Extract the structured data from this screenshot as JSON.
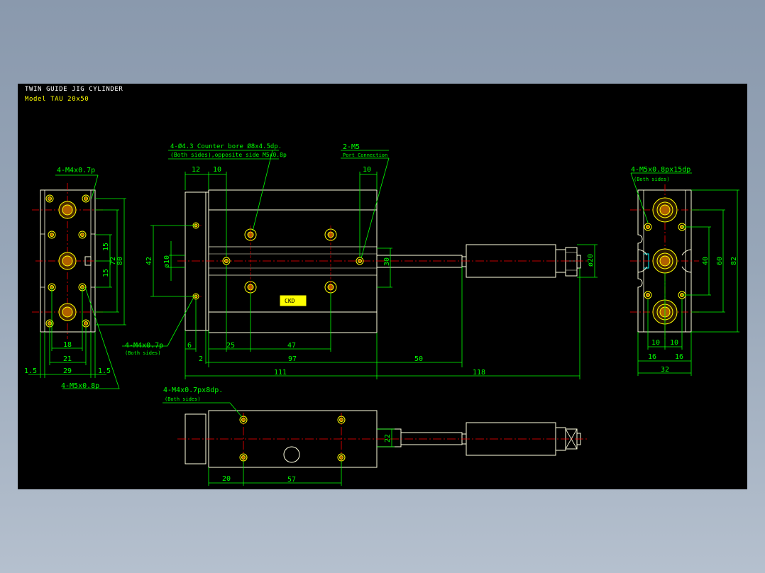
{
  "title_block": {
    "line1": "TWIN GUIDE JIG CYLINDER",
    "line2": "Model TAU 20x50"
  },
  "colors": {
    "background": "#000000",
    "outline": "#ffffe0",
    "dimension": "#00ff00",
    "centerline": "#ff0000",
    "hole": "#ffff00",
    "hole_fill": "#b06000",
    "label_cyan": "#00ffff",
    "title_white": "#ffffff",
    "title_yellow": "#ffff00"
  },
  "left_view": {
    "note_top": "4-M4x0.7p",
    "note_bottom": "4-M5x0.8p",
    "dim_15_upper": "15",
    "dim_15_lower": "15",
    "dim_72": "72",
    "dim_80": "80",
    "dim_18": "18",
    "dim_21": "21",
    "dim_29": "29",
    "dim_1_5_left": "1.5",
    "dim_1_5_right": "1.5"
  },
  "front_view": {
    "note_counterbore_1": "4-Ø4.3 Counter bore Ø8x4.5dp.",
    "note_counterbore_2": "(Both sides),opposite side M5x0.8p",
    "note_port_1": "2-M5",
    "note_port_2": "Port Connection",
    "note_bottom_1": "4-M4x0.7p",
    "note_bottom_2": "(Both sides)",
    "dim_12": "12",
    "dim_10_left": "10",
    "dim_10_right": "10",
    "dim_42": "42",
    "dim_phi10": "ø10",
    "dim_30": "30",
    "dim_phi20": "ø20",
    "dim_6": "6",
    "dim_25": "25",
    "dim_47": "47",
    "dim_2": "2",
    "dim_97": "97",
    "dim_50": "50",
    "dim_111": "111",
    "dim_118": "118",
    "nameplate": "CKD"
  },
  "right_view": {
    "note_1": "4-M5x0.8px15dp",
    "note_2": "(Both sides)",
    "dim_40": "40",
    "dim_60": "60",
    "dim_82": "82",
    "dim_10_left": "10",
    "dim_10_right": "10",
    "dim_16_left": "16",
    "dim_16_right": "16",
    "dim_32": "32"
  },
  "bottom_view": {
    "note_1": "4-M4x0.7px8dp.",
    "note_2": "(Both sides)",
    "dim_22": "22",
    "dim_20": "20",
    "dim_57": "57"
  }
}
